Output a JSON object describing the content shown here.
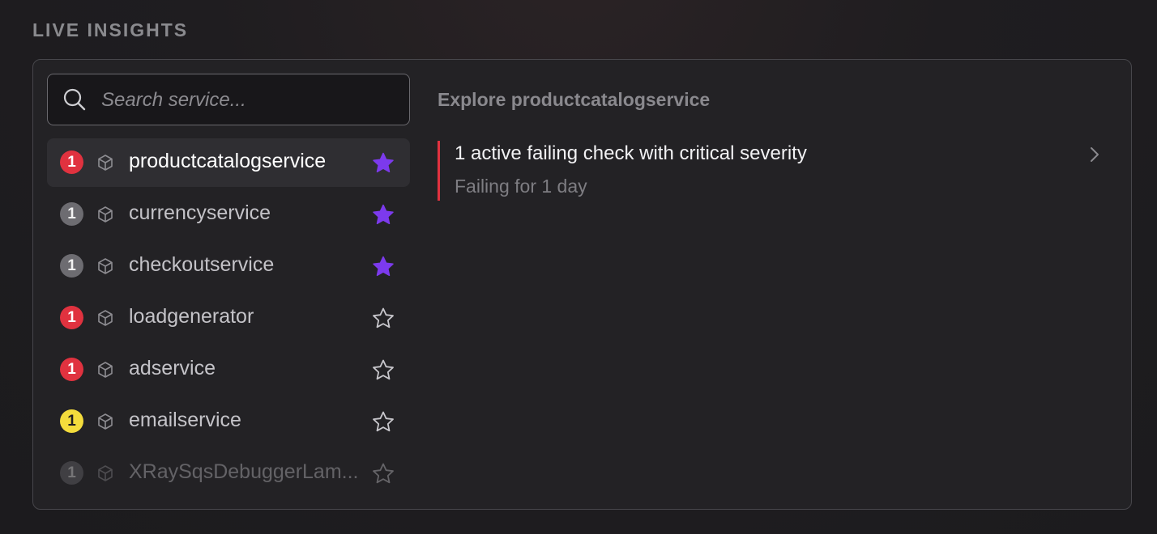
{
  "section": {
    "title": "LIVE INSIGHTS"
  },
  "search": {
    "placeholder": "Search service...",
    "value": "",
    "icon": "search-icon"
  },
  "services": [
    {
      "name": "productcatalogservice",
      "count": "1",
      "severity": "critical",
      "favorite": true,
      "selected": true
    },
    {
      "name": "currencyservice",
      "count": "1",
      "severity": "neutral",
      "favorite": true,
      "selected": false
    },
    {
      "name": "checkoutservice",
      "count": "1",
      "severity": "neutral",
      "favorite": true,
      "selected": false
    },
    {
      "name": "loadgenerator",
      "count": "1",
      "severity": "critical",
      "favorite": false,
      "selected": false
    },
    {
      "name": "adservice",
      "count": "1",
      "severity": "critical",
      "favorite": false,
      "selected": false
    },
    {
      "name": "emailservice",
      "count": "1",
      "severity": "warning",
      "favorite": false,
      "selected": false
    },
    {
      "name": "XRaySqsDebuggerLam...",
      "count": "1",
      "severity": "neutral",
      "favorite": false,
      "selected": false
    }
  ],
  "explore": {
    "title": "Explore productcatalogservice",
    "insight_title": "1 active failing check with critical severity",
    "insight_subtitle": "Failing for 1 day"
  },
  "colors": {
    "critical": "#e0323f",
    "warning": "#f4dc3c",
    "neutral": "#6d6c71",
    "favorite": "#7c3aed",
    "accent_border": "#e0323f"
  }
}
